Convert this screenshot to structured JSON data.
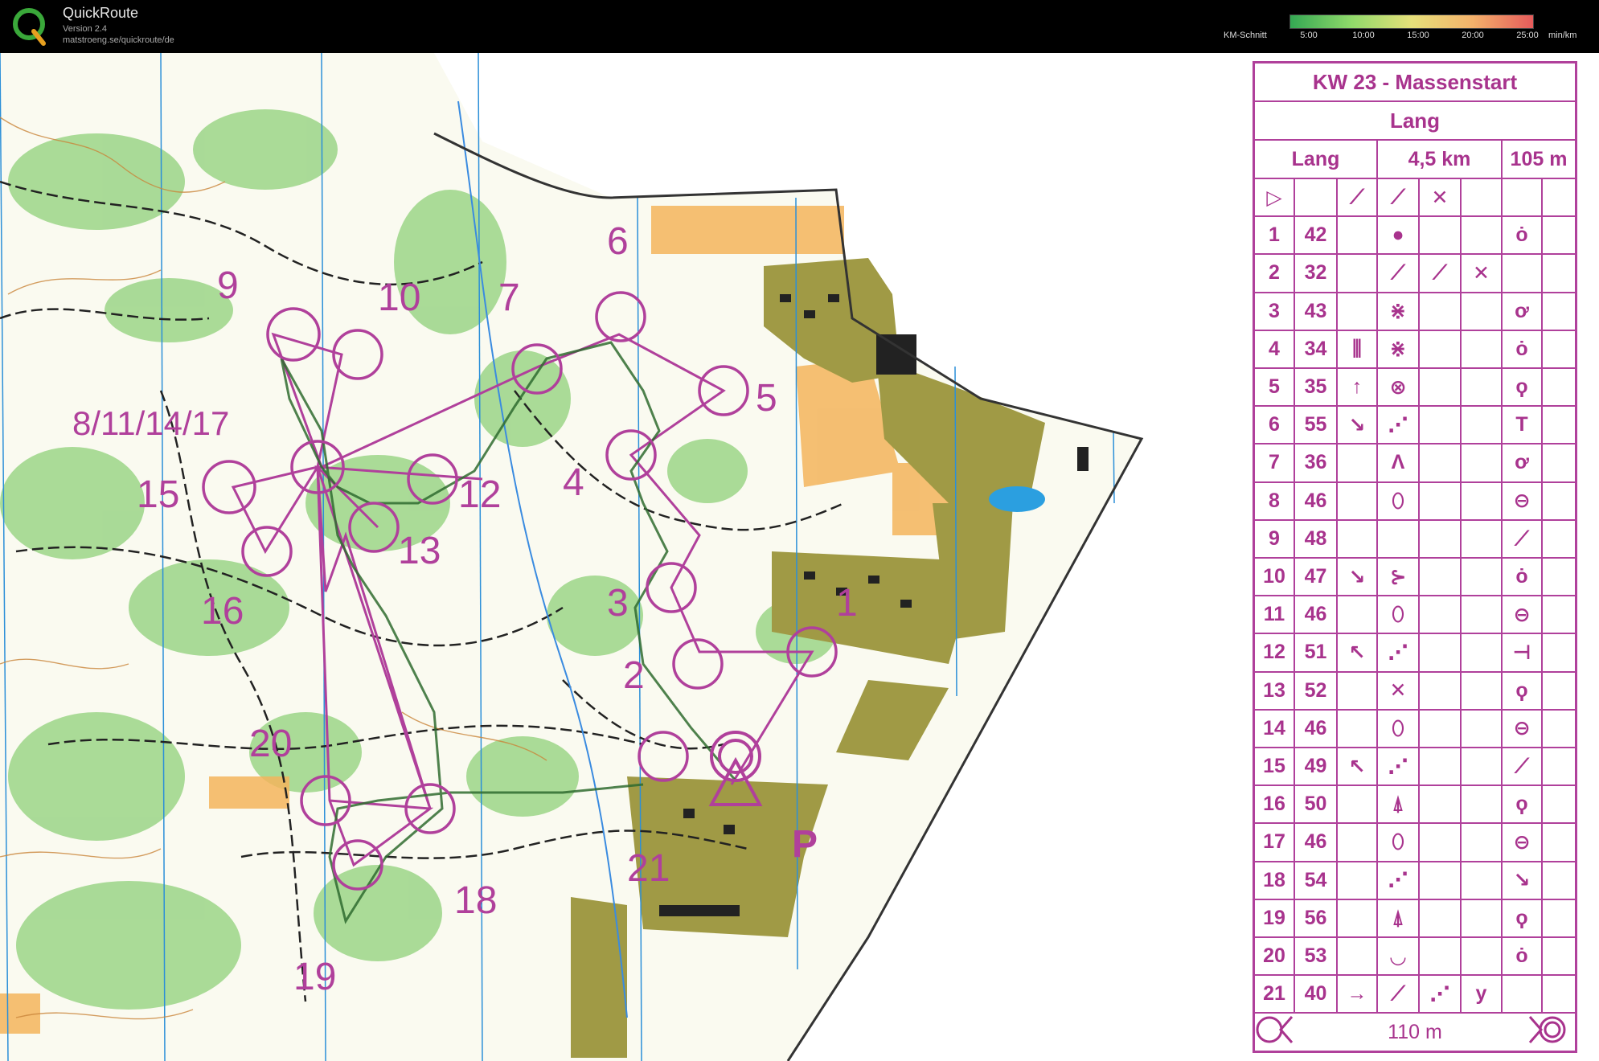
{
  "app": {
    "name": "QuickRoute",
    "version": "Version 2.4",
    "url": "matstroeng.se/quickroute/de"
  },
  "legend": {
    "label": "KM-Schnitt",
    "ticks": [
      "5:00",
      "10:00",
      "15:00",
      "20:00",
      "25:00"
    ],
    "unit": "min/km"
  },
  "map": {
    "control_labels": [
      "9",
      "10",
      "7",
      "6",
      "5",
      "8/11/14/17",
      "15",
      "12",
      "4",
      "13",
      "16",
      "3",
      "1",
      "2",
      "20",
      "21",
      "18",
      "19"
    ],
    "parking_label": "P"
  },
  "description": {
    "title": "KW 23 - Massenstart",
    "class": "Lang",
    "course": "Lang",
    "length": "4,5 km",
    "climb": "105 m",
    "start_symbols": [
      "▷",
      "",
      "⟋",
      "⟋",
      "✕",
      ""
    ],
    "controls": [
      {
        "num": "1",
        "code": "42",
        "c": "",
        "d": "●",
        "e": "",
        "f": "",
        "g": "ȯ"
      },
      {
        "num": "2",
        "code": "32",
        "c": "",
        "d": "⟋",
        "e": "⟋",
        "f": "✕",
        "g": ""
      },
      {
        "num": "3",
        "code": "43",
        "c": "",
        "d": "⋇",
        "e": "",
        "f": "",
        "g": "ơ"
      },
      {
        "num": "4",
        "code": "34",
        "c": "⫼",
        "d": "⋇",
        "e": "",
        "f": "",
        "g": "ȯ"
      },
      {
        "num": "5",
        "code": "35",
        "c": "↑",
        "d": "⊗",
        "e": "",
        "f": "",
        "g": "ϙ"
      },
      {
        "num": "6",
        "code": "55",
        "c": "↘",
        "d": "⋰",
        "e": "",
        "f": "",
        "g": "Τ"
      },
      {
        "num": "7",
        "code": "36",
        "c": "",
        "d": "Λ",
        "e": "",
        "f": "",
        "g": "ơ"
      },
      {
        "num": "8",
        "code": "46",
        "c": "",
        "d": "⬯",
        "e": "",
        "f": "",
        "g": "⊖"
      },
      {
        "num": "9",
        "code": "48",
        "c": "",
        "d": "",
        "e": "",
        "f": "",
        "g": "⟋"
      },
      {
        "num": "10",
        "code": "47",
        "c": "↘",
        "d": "⊱",
        "e": "",
        "f": "",
        "g": "ȯ"
      },
      {
        "num": "11",
        "code": "46",
        "c": "",
        "d": "⬯",
        "e": "",
        "f": "",
        "g": "⊖"
      },
      {
        "num": "12",
        "code": "51",
        "c": "↖",
        "d": "⋰",
        "e": "",
        "f": "",
        "g": "⊣"
      },
      {
        "num": "13",
        "code": "52",
        "c": "",
        "d": "✕",
        "e": "",
        "f": "",
        "g": "ϙ"
      },
      {
        "num": "14",
        "code": "46",
        "c": "",
        "d": "⬯",
        "e": "",
        "f": "",
        "g": "⊖"
      },
      {
        "num": "15",
        "code": "49",
        "c": "↖",
        "d": "⋰",
        "e": "",
        "f": "",
        "g": "⟋"
      },
      {
        "num": "16",
        "code": "50",
        "c": "",
        "d": "⍋",
        "e": "",
        "f": "",
        "g": "ϙ"
      },
      {
        "num": "17",
        "code": "46",
        "c": "",
        "d": "⬯",
        "e": "",
        "f": "",
        "g": "⊖"
      },
      {
        "num": "18",
        "code": "54",
        "c": "",
        "d": "⋰",
        "e": "",
        "f": "",
        "g": "↘"
      },
      {
        "num": "19",
        "code": "56",
        "c": "",
        "d": "⍋",
        "e": "",
        "f": "",
        "g": "ϙ"
      },
      {
        "num": "20",
        "code": "53",
        "c": "",
        "d": "◡",
        "e": "",
        "f": "",
        "g": "ȯ"
      },
      {
        "num": "21",
        "code": "40",
        "c": "→",
        "d": "⟋",
        "e": "⋰",
        "f": "y",
        "g": ""
      }
    ],
    "finish_distance": "110 m"
  },
  "colors": {
    "purple": "#b0409b",
    "forest_green": "#7cc36b",
    "open_yellow": "#f3b45c",
    "building_olive": "#9a9540"
  }
}
